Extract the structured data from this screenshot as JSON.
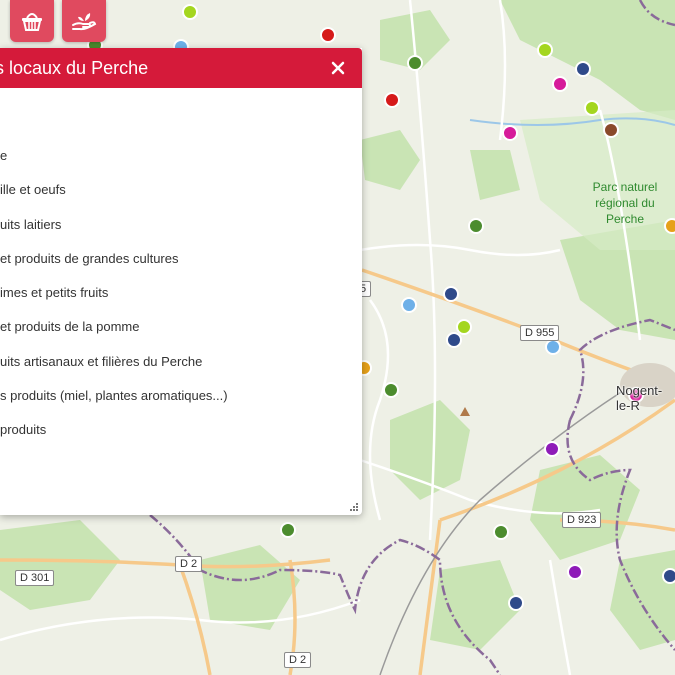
{
  "toolbar": {
    "basket_icon": "basket-icon",
    "hand_icon": "hand-plant-icon"
  },
  "panel": {
    "title": "uits locaux du Perche",
    "close_icon": "close-icon",
    "categories": [
      "",
      "e",
      "ille et oeufs",
      "uits laitiers",
      "et produits de grandes cultures",
      "imes et petits fruits",
      "et produits de la pomme",
      "uits artisanaux et filières du Perche",
      "s produits (miel, plantes aromatiques...)",
      "produits"
    ]
  },
  "map": {
    "park_label": "Parc naturel régional du Perche",
    "town_label": "Nogent-le-R",
    "roads": {
      "d955": "D 955",
      "d923": "D 923",
      "d2_a": "D 2",
      "d2_b": "D 2",
      "d301": "D 301",
      "d5": "5"
    },
    "colors": {
      "lime": "#a4d61f",
      "red": "#d61a1a",
      "green": "#4c8c2e",
      "navy": "#2f4a8a",
      "magenta": "#d61b9a",
      "brown": "#8a4a2a",
      "lightblue": "#6eb0e8",
      "orange": "#e6a11a",
      "purple": "#8e1bb8",
      "brand": "#d51a3a"
    }
  }
}
